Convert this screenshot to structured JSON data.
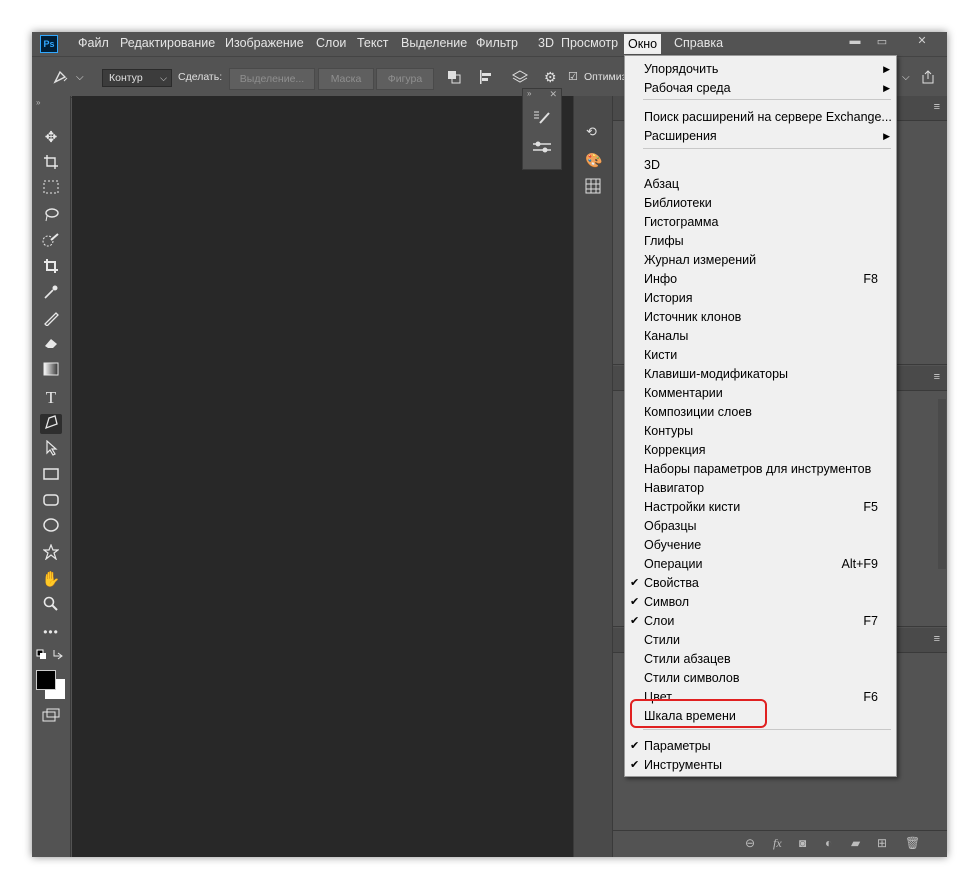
{
  "app": {
    "logo": "Ps"
  },
  "menubar": {
    "items": [
      "Файл",
      "Редактирование",
      "Изображение",
      "Слои",
      "Текст",
      "Выделение",
      "Фильтр",
      "3D",
      "Просмотр",
      "Окно",
      "Справка"
    ],
    "active": "Окно"
  },
  "window_controls": {
    "minimize": "▬",
    "maximize": "▭",
    "close": "✕"
  },
  "options_bar": {
    "mode_dropdown": "Контур",
    "make_label": "Сделать:",
    "selection_button": "Выделение...",
    "mask_button": "Маска",
    "shape_button": "Фигура",
    "optimize_label": "Оптимиз"
  },
  "window_menu": {
    "items": [
      {
        "label": "Упорядочить",
        "submenu": true,
        "checked": false,
        "shortcut": ""
      },
      {
        "label": "Рабочая среда",
        "submenu": true,
        "checked": false,
        "shortcut": ""
      },
      {
        "label": "Поиск расширений на сервере Exchange...",
        "submenu": false,
        "checked": false,
        "shortcut": ""
      },
      {
        "label": "Расширения",
        "submenu": true,
        "checked": false,
        "shortcut": ""
      },
      {
        "label": "3D",
        "submenu": false,
        "checked": false,
        "shortcut": ""
      },
      {
        "label": "Абзац",
        "submenu": false,
        "checked": false,
        "shortcut": ""
      },
      {
        "label": "Библиотеки",
        "submenu": false,
        "checked": false,
        "shortcut": ""
      },
      {
        "label": "Гистограмма",
        "submenu": false,
        "checked": false,
        "shortcut": ""
      },
      {
        "label": "Глифы",
        "submenu": false,
        "checked": false,
        "shortcut": ""
      },
      {
        "label": "Журнал измерений",
        "submenu": false,
        "checked": false,
        "shortcut": ""
      },
      {
        "label": "Инфо",
        "submenu": false,
        "checked": false,
        "shortcut": "F8"
      },
      {
        "label": "История",
        "submenu": false,
        "checked": false,
        "shortcut": ""
      },
      {
        "label": "Источник клонов",
        "submenu": false,
        "checked": false,
        "shortcut": ""
      },
      {
        "label": "Каналы",
        "submenu": false,
        "checked": false,
        "shortcut": ""
      },
      {
        "label": "Кисти",
        "submenu": false,
        "checked": false,
        "shortcut": ""
      },
      {
        "label": "Клавиши-модификаторы",
        "submenu": false,
        "checked": false,
        "shortcut": ""
      },
      {
        "label": "Комментарии",
        "submenu": false,
        "checked": false,
        "shortcut": ""
      },
      {
        "label": "Композиции слоев",
        "submenu": false,
        "checked": false,
        "shortcut": ""
      },
      {
        "label": "Контуры",
        "submenu": false,
        "checked": false,
        "shortcut": ""
      },
      {
        "label": "Коррекция",
        "submenu": false,
        "checked": false,
        "shortcut": ""
      },
      {
        "label": "Наборы параметров для инструментов",
        "submenu": false,
        "checked": false,
        "shortcut": ""
      },
      {
        "label": "Навигатор",
        "submenu": false,
        "checked": false,
        "shortcut": ""
      },
      {
        "label": "Настройки кисти",
        "submenu": false,
        "checked": false,
        "shortcut": "F5"
      },
      {
        "label": "Образцы",
        "submenu": false,
        "checked": false,
        "shortcut": ""
      },
      {
        "label": "Обучение",
        "submenu": false,
        "checked": false,
        "shortcut": ""
      },
      {
        "label": "Операции",
        "submenu": false,
        "checked": false,
        "shortcut": "Alt+F9"
      },
      {
        "label": "Свойства",
        "submenu": false,
        "checked": true,
        "shortcut": ""
      },
      {
        "label": "Символ",
        "submenu": false,
        "checked": true,
        "shortcut": ""
      },
      {
        "label": "Слои",
        "submenu": false,
        "checked": true,
        "shortcut": "F7"
      },
      {
        "label": "Стили",
        "submenu": false,
        "checked": false,
        "shortcut": ""
      },
      {
        "label": "Стили абзацев",
        "submenu": false,
        "checked": false,
        "shortcut": ""
      },
      {
        "label": "Стили символов",
        "submenu": false,
        "checked": false,
        "shortcut": ""
      },
      {
        "label": "Цвет",
        "submenu": false,
        "checked": false,
        "shortcut": "F6"
      },
      {
        "label": "Шкала времени",
        "submenu": false,
        "checked": false,
        "shortcut": "",
        "highlighted": true
      },
      {
        "label": "Параметры",
        "submenu": false,
        "checked": true,
        "shortcut": ""
      },
      {
        "label": "Инструменты",
        "submenu": false,
        "checked": true,
        "shortcut": ""
      }
    ]
  },
  "tools": [
    "move-icon",
    "artboard-icon",
    "marquee-icon",
    "lasso-icon",
    "quick-select-icon",
    "crop-icon",
    "eyedropper-icon",
    "brush-icon",
    "eraser-icon",
    "gradient-icon",
    "type-icon",
    "pen-icon",
    "path-select-icon",
    "rectangle-icon",
    "rounded-rect-icon",
    "ellipse-icon",
    "custom-shape-icon",
    "hand-icon",
    "zoom-icon",
    "more-icon"
  ],
  "colors": {
    "highlight_border": "#e02020",
    "panel_bg": "#535353",
    "canvas_bg": "#282828",
    "menu_bg": "#f0f0f0"
  }
}
